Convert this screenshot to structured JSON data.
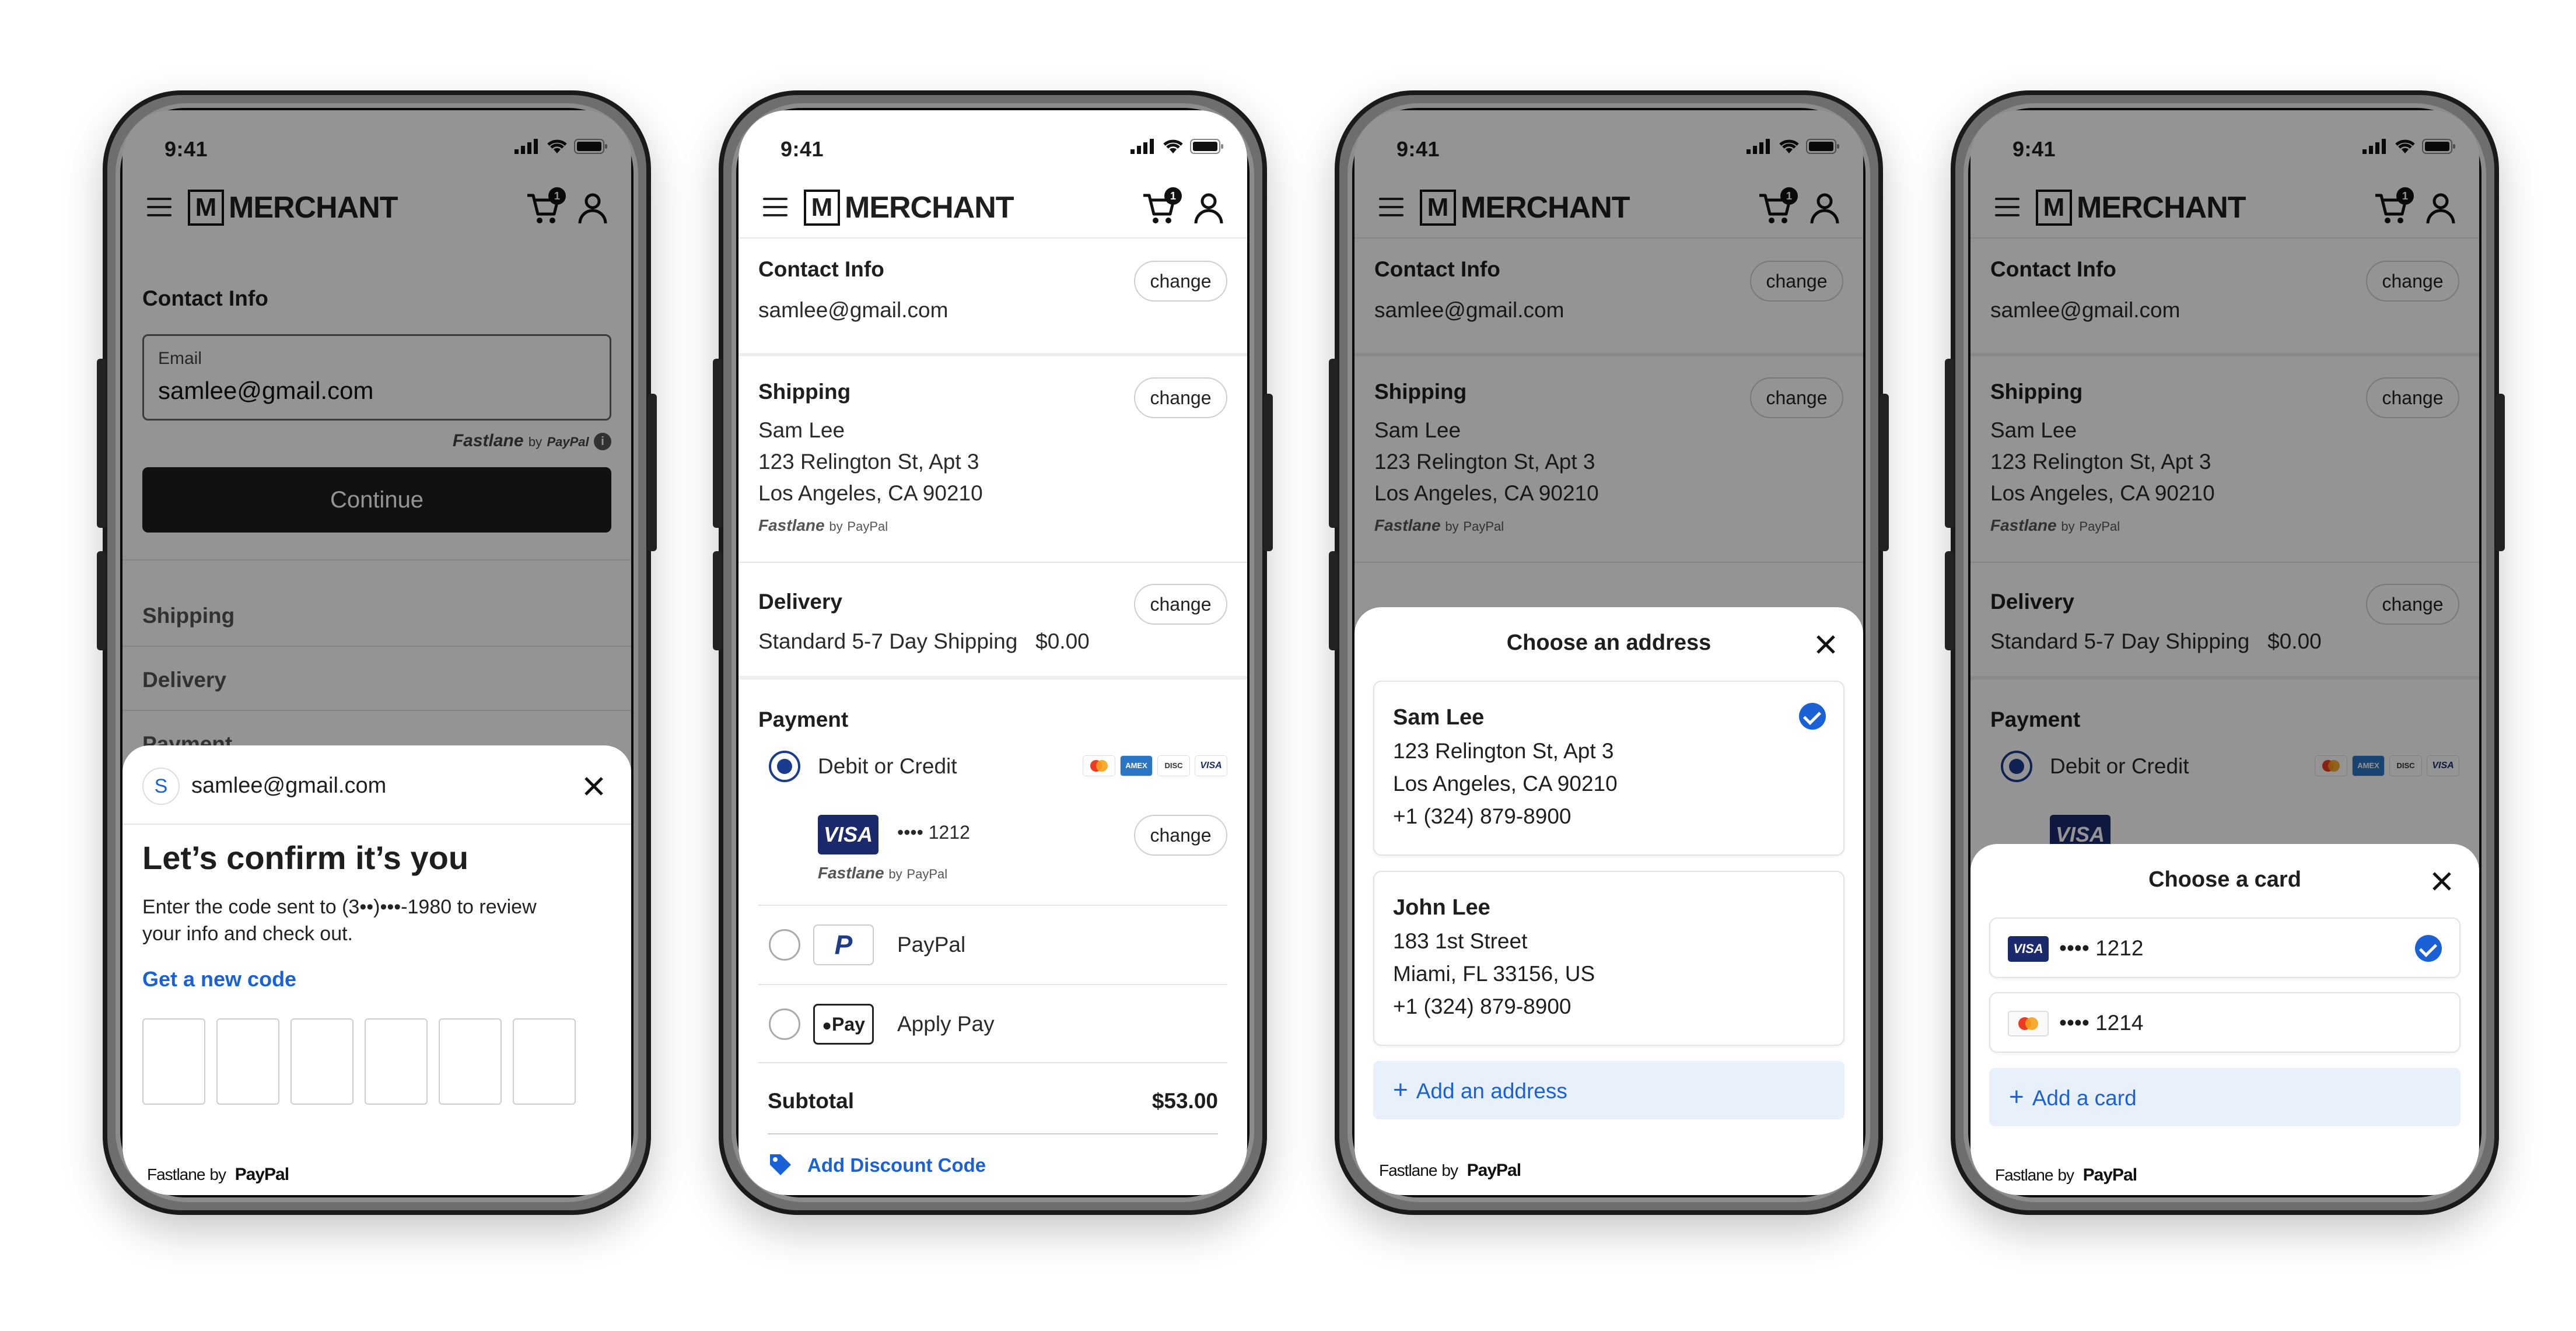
{
  "status": {
    "time": "9:41"
  },
  "brand": {
    "mark": "M",
    "name": "MERCHANT",
    "cart_count": "1"
  },
  "fastlane": {
    "name": "Fastlane",
    "by": "by",
    "paypal": "PayPal"
  },
  "phone1": {
    "contact_title": "Contact Info",
    "email_label": "Email",
    "email_value": "samlee@gmail.com",
    "continue_label": "Continue",
    "sections": [
      "Shipping",
      "Delivery",
      "Payment"
    ],
    "sheet": {
      "avatar_initial": "S",
      "email": "samlee@gmail.com",
      "title": "Let’s confirm it’s you",
      "body_line1": "Enter the code sent to (3••)•••-1980 to review",
      "body_line2": "your info and check out.",
      "new_code_link": "Get a new code"
    }
  },
  "checkout": {
    "contact_title": "Contact Info",
    "contact_email": "samlee@gmail.com",
    "change_label": "change",
    "shipping_title": "Shipping",
    "shipping_lines": [
      "Sam Lee",
      "123 Relington St, Apt 3",
      "Los Angeles, CA 90210"
    ],
    "delivery_title": "Delivery",
    "delivery_method": "Standard 5-7 Day Shipping",
    "delivery_price": "$0.00",
    "payment_title": "Payment",
    "debit_label": "Debit or Credit",
    "card_masked": "•••• 1212",
    "paypal_label": "PayPal",
    "applepay_label": "Apply Pay",
    "applepay_badge": "Pay",
    "subtotal_label": "Subtotal",
    "subtotal_value": "$53.00",
    "discount_link": "Add Discount Code",
    "card_brands": [
      "mastercard",
      "amex",
      "discover",
      "visa"
    ]
  },
  "address_sheet": {
    "title": "Choose an address",
    "addresses": [
      {
        "name": "Sam Lee",
        "line1": "123 Relington St, Apt 3",
        "line2": "Los Angeles, CA 90210",
        "phone": "+1 (324) 879-8900",
        "selected": true
      },
      {
        "name": "John Lee",
        "line1": "183 1st Street",
        "line2": "Miami, FL 33156, US",
        "phone": "+1 (324) 879-8900",
        "selected": false
      }
    ],
    "add_label": "Add an address"
  },
  "card_sheet": {
    "title": "Choose a card",
    "cards": [
      {
        "brand": "VISA",
        "masked": "•••• 1212",
        "selected": true
      },
      {
        "brand": "mastercard",
        "masked": "•••• 1214",
        "selected": false
      }
    ],
    "add_label": "Add a card"
  },
  "colors": {
    "accent": "#1b61d6",
    "visa_navy": "#1a2a6c",
    "dark_button": "#1e1e1e",
    "add_bg": "#e8f0fb"
  },
  "icons": [
    "hamburger-icon",
    "cart-icon",
    "user-icon",
    "close-icon",
    "check-icon",
    "info-icon",
    "plus-icon",
    "tag-icon",
    "signal-icon",
    "wifi-icon",
    "battery-icon"
  ]
}
